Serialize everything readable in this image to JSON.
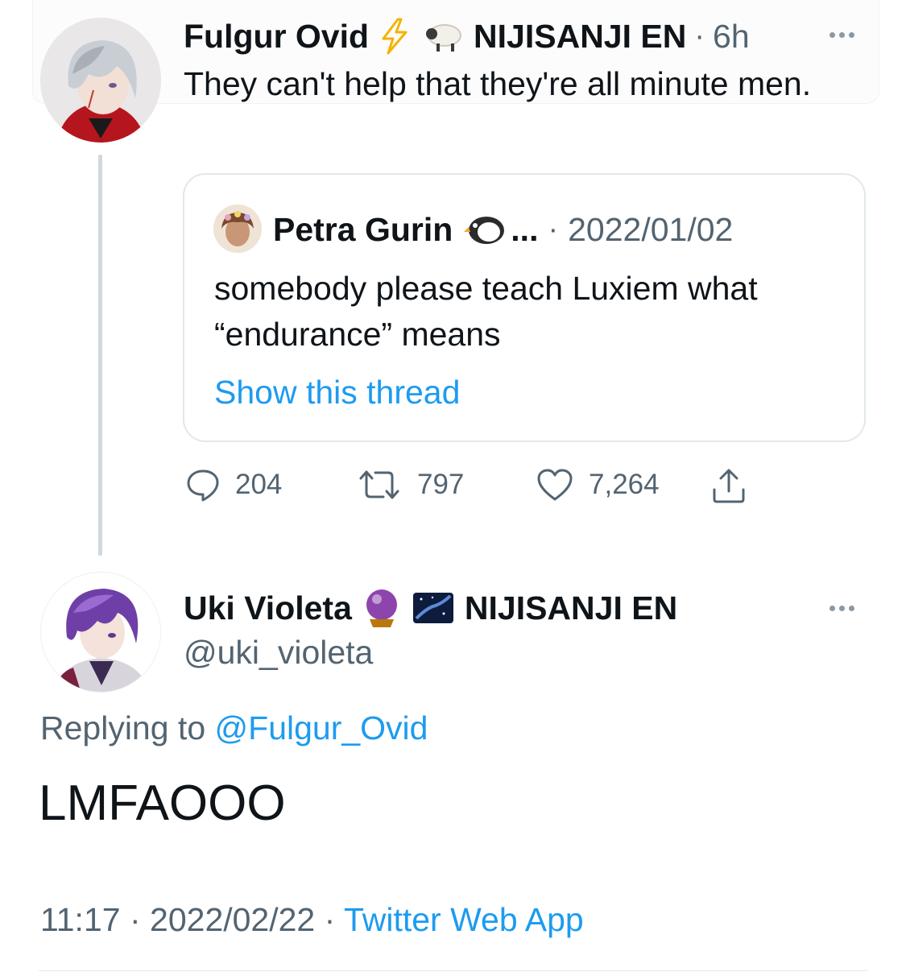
{
  "top_tweet": {
    "name": "Fulgur Ovid",
    "badge_emoji_1": "⚡",
    "badge_emoji_2": "🐑",
    "affiliation": "NIJISANJI EN",
    "separator": "·",
    "time": "6h",
    "text": "They can't help that they're all minute men.",
    "quote": {
      "name": "Petra Gurin",
      "badge_emoji": "🐧",
      "ellipsis": "...",
      "separator": "·",
      "date": "2022/01/02",
      "text": "somebody please teach Luxiem what “endurance” means",
      "show_thread": "Show this thread"
    },
    "actions": {
      "replies": "204",
      "retweets": "797",
      "likes": "7,264"
    }
  },
  "reply_tweet": {
    "name": "Uki Violeta",
    "badge_emoji_1": "🔮",
    "badge_emoji_2": "🌌",
    "affiliation": "NIJISANJI EN",
    "handle": "@uki_violeta",
    "replying_prefix": "Replying to",
    "replying_handle": "@Fulgur_Ovid",
    "text": "LMFAOOO",
    "time": "11:17",
    "date": "2022/02/22",
    "source": "Twitter Web App",
    "separator": "·"
  },
  "colors": {
    "accent": "#1d9bf0",
    "muted": "#536471",
    "text": "#0f1419",
    "thread_line": "#cfd9de"
  }
}
